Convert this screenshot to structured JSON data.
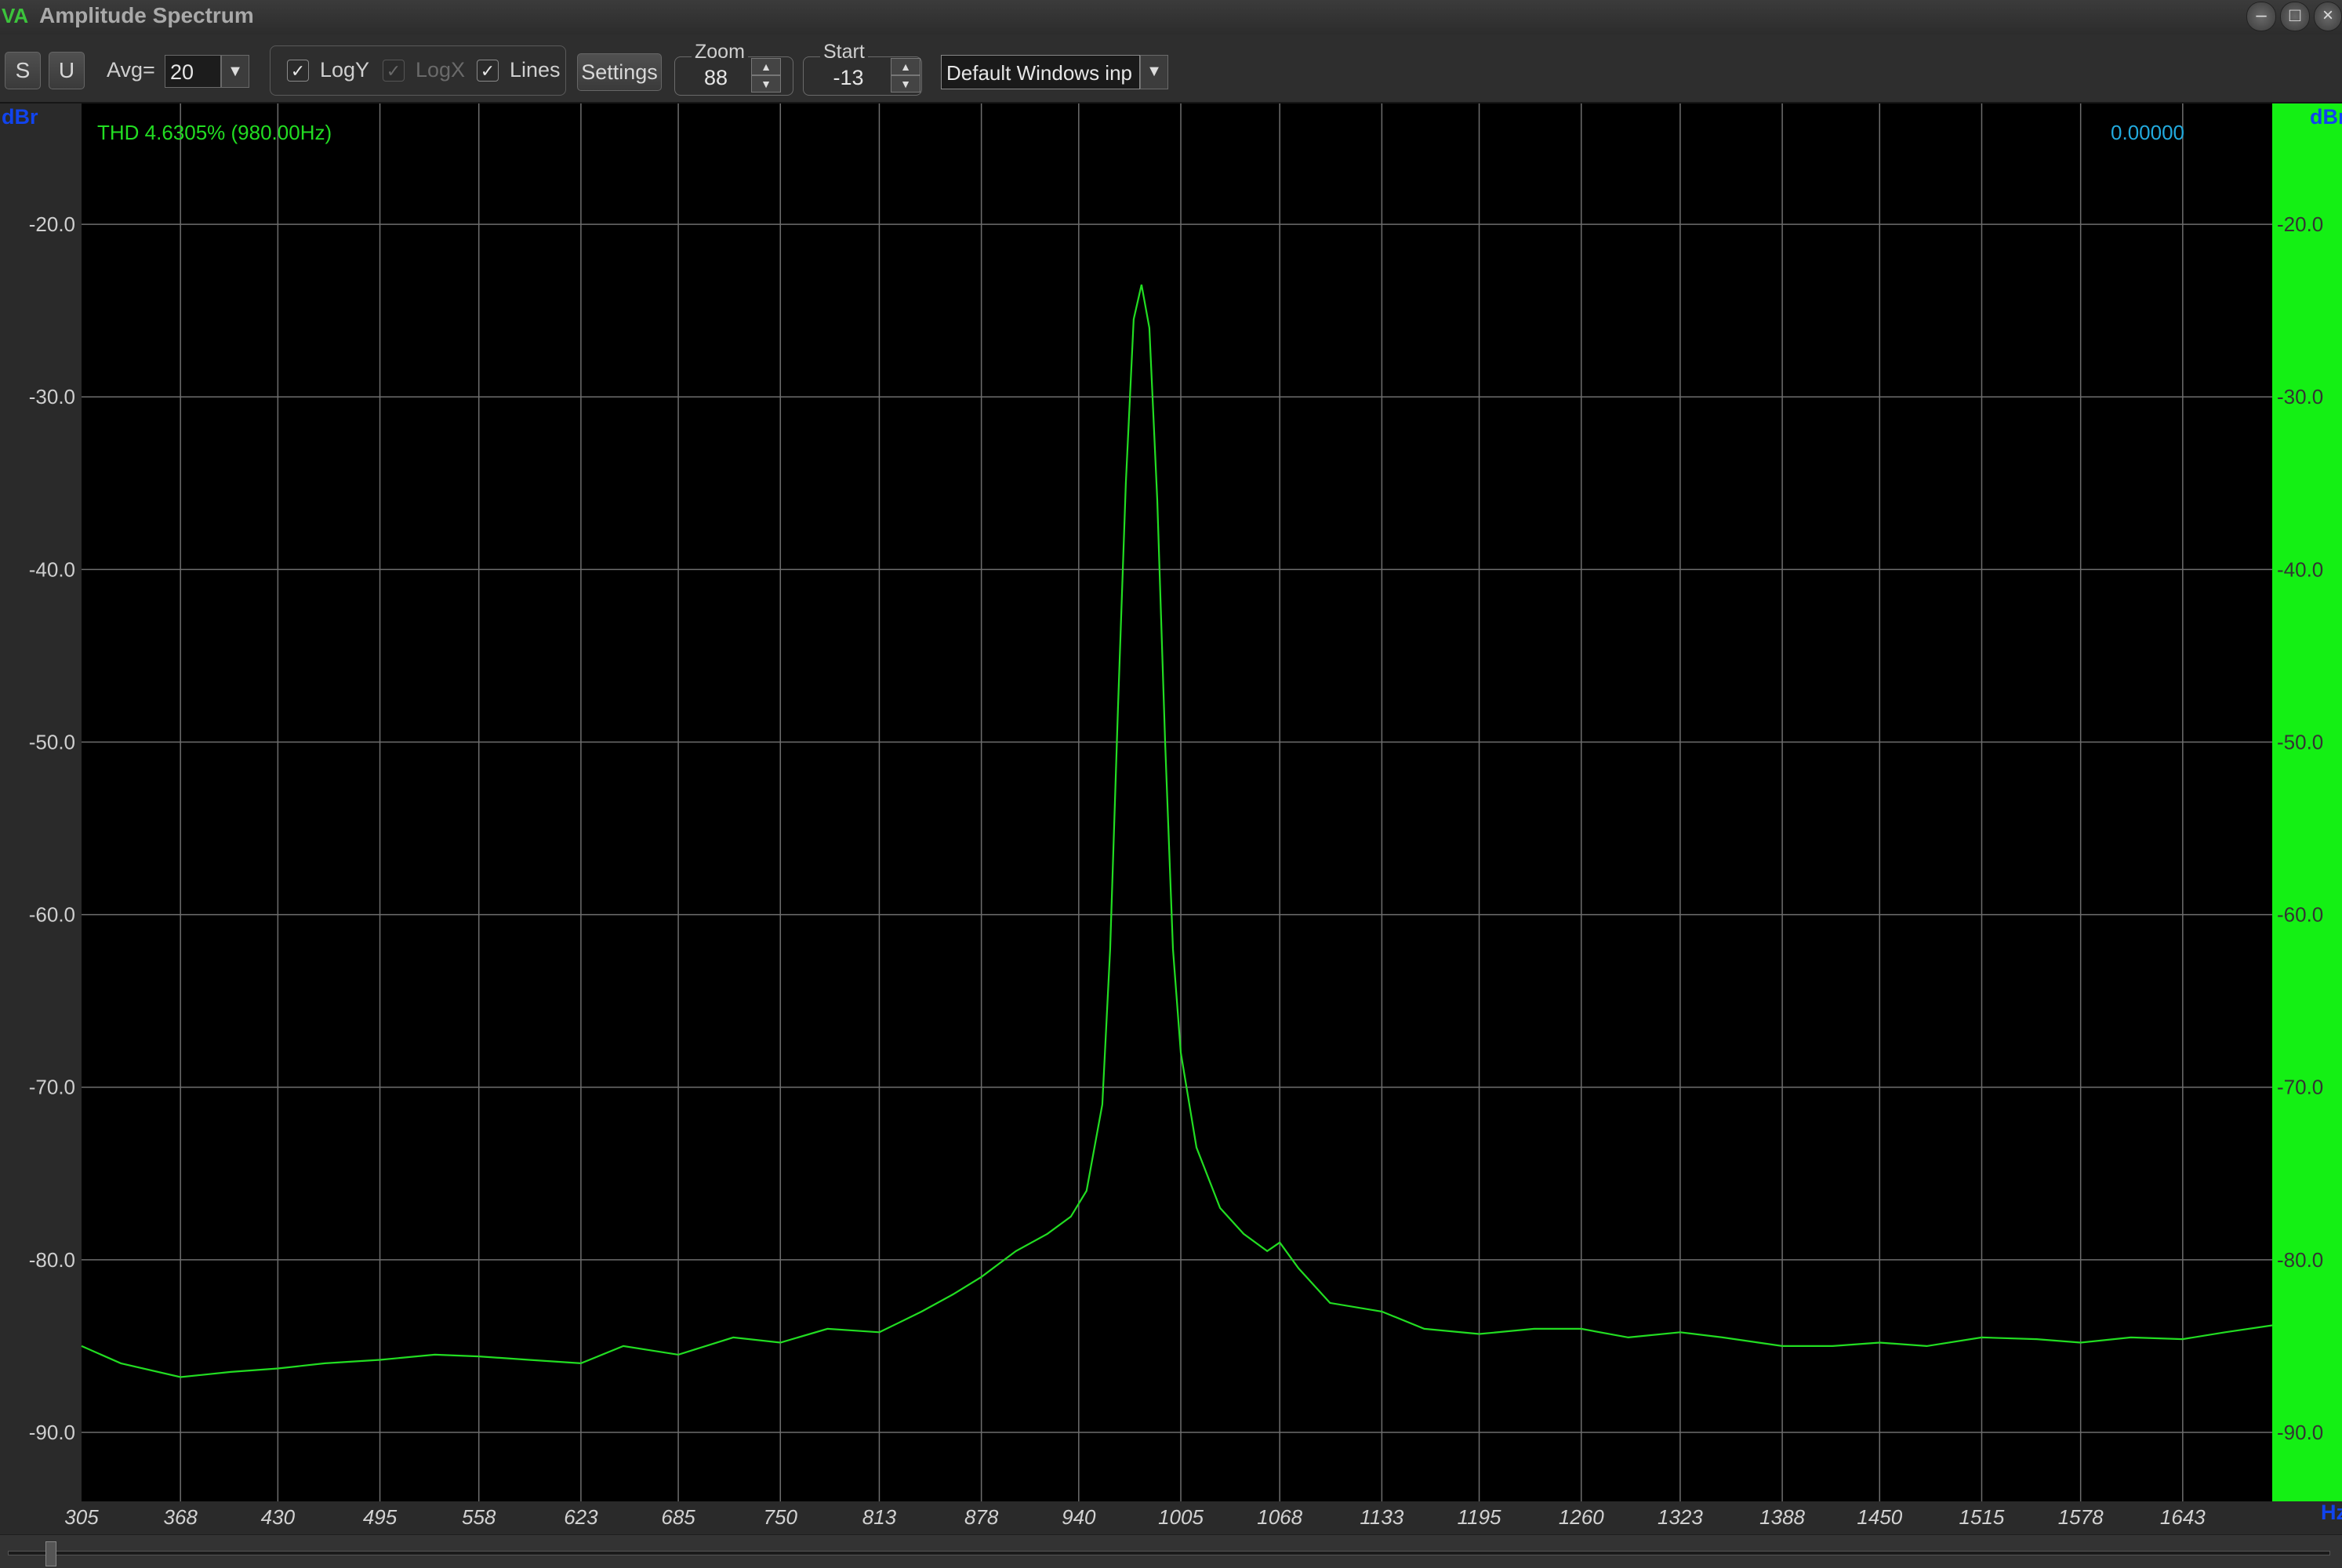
{
  "window": {
    "title": "Amplitude Spectrum",
    "icon": "VA"
  },
  "toolbar": {
    "s_label": "S",
    "u_label": "U",
    "avg_label": "Avg=",
    "avg_value": "20",
    "logy_label": "LogY",
    "logx_label": "LogX",
    "lines_label": "Lines",
    "settings_label": "Settings",
    "zoom_label": "Zoom",
    "zoom_value": "88",
    "start_label": "Start",
    "start_value": "-13",
    "input_device": "Default Windows inp"
  },
  "readouts": {
    "thd": "THD  4.6305% (980.00Hz)",
    "cursor_value": "0.00000",
    "left_unit": "dBr",
    "right_unit": "dBr",
    "x_unit": "Hz"
  },
  "colors": {
    "trace": "#22dd22",
    "thd_text": "#22dd22",
    "cursor_text": "#22aadd",
    "level_bar": "#14f014",
    "grid": "#6e6e6e",
    "plot_bg": "#000000"
  },
  "chart_data": {
    "type": "line",
    "y_ticks": [
      "-20.0",
      "-30.0",
      "-40.0",
      "-50.0",
      "-60.0",
      "-70.0",
      "-80.0",
      "-90.0"
    ],
    "x_ticks": [
      "305",
      "368",
      "430",
      "495",
      "558",
      "623",
      "685",
      "750",
      "813",
      "878",
      "940",
      "1005",
      "1068",
      "1133",
      "1195",
      "1260",
      "1323",
      "1388",
      "1450",
      "1515",
      "1578",
      "1643"
    ],
    "xlim": [
      305,
      1700
    ],
    "ylim": [
      -94.0,
      -13.0
    ],
    "series": [
      {
        "x": [
          305,
          330,
          368,
          400,
          430,
          460,
          495,
          530,
          558,
          590,
          623,
          650,
          685,
          720,
          750,
          780,
          813,
          840,
          860,
          878,
          900,
          920,
          935,
          945,
          955,
          960,
          965,
          970,
          975,
          980,
          985,
          990,
          995,
          1000,
          1005,
          1015,
          1030,
          1045,
          1060,
          1068,
          1080,
          1100,
          1133,
          1160,
          1195,
          1230,
          1260,
          1290,
          1323,
          1350,
          1388,
          1420,
          1450,
          1480,
          1515,
          1550,
          1578,
          1610,
          1643,
          1670,
          1700
        ],
        "y": [
          -85.0,
          -86.0,
          -86.8,
          -86.5,
          -86.3,
          -86.0,
          -85.8,
          -85.5,
          -85.6,
          -85.8,
          -86.0,
          -85.0,
          -85.5,
          -84.5,
          -84.8,
          -84.0,
          -84.2,
          -83.0,
          -82.0,
          -81.0,
          -79.5,
          -78.5,
          -77.5,
          -76.0,
          -71.0,
          -62.0,
          -48.0,
          -35.0,
          -25.5,
          -23.5,
          -26.0,
          -36.0,
          -50.0,
          -62.0,
          -68.0,
          -73.5,
          -77.0,
          -78.5,
          -79.5,
          -79.0,
          -80.5,
          -82.5,
          -83.0,
          -84.0,
          -84.3,
          -84.0,
          -84.0,
          -84.5,
          -84.2,
          -84.5,
          -85.0,
          -85.0,
          -84.8,
          -85.0,
          -84.5,
          -84.6,
          -84.8,
          -84.5,
          -84.6,
          -84.2,
          -83.8
        ]
      }
    ]
  }
}
